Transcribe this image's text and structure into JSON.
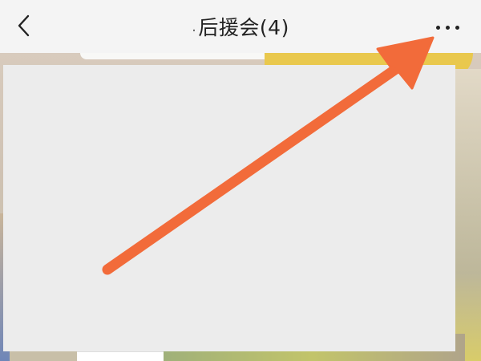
{
  "header": {
    "back_icon": "chevron-left-icon",
    "title": "后援会(4)",
    "title_prefix": ".",
    "more_icon": "more-horizontal-icon"
  },
  "annotation": {
    "arrow_color": "#f26b3a",
    "arrow_target": "more-button"
  },
  "colors": {
    "header_bg": "#f4f4f4",
    "panel_bg": "#ececec",
    "text": "#222222"
  }
}
